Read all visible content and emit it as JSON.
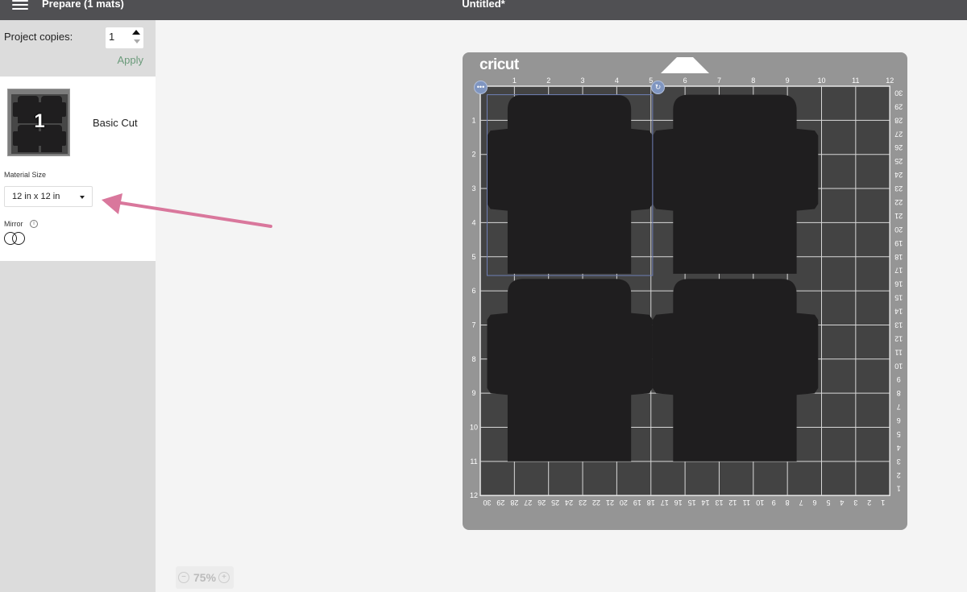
{
  "topbar": {
    "menu_icon": "hamburger-menu-icon",
    "prepare_label": "Prepare (1 mats)",
    "project_title": "Untitled*"
  },
  "left_panel": {
    "project_copies_label": "Project copies:",
    "project_copies_value": "1",
    "apply_label": "Apply",
    "mat": {
      "number": "1",
      "cut_type": "Basic Cut",
      "material_size_label": "Material Size",
      "material_size_value": "12 in x 12 in",
      "mirror_label": "Mirror",
      "mirror_on": false
    }
  },
  "canvas": {
    "zoom_level": "75%",
    "zoom_out_icon": "minus-icon",
    "zoom_in_icon": "plus-icon",
    "annotation_arrow_color": "#d9779c",
    "mat": {
      "brand": "cricut",
      "size_in": [
        12,
        12
      ],
      "top_ruler": [
        "1",
        "2",
        "3",
        "4",
        "5",
        "6",
        "7",
        "8",
        "9",
        "10",
        "11",
        "12"
      ],
      "left_ruler": [
        "1",
        "2",
        "3",
        "4",
        "5",
        "6",
        "7",
        "8",
        "9",
        "10",
        "11",
        "12"
      ],
      "right_ruler_cm": [
        "30",
        "29",
        "28",
        "27",
        "26",
        "25",
        "24",
        "23",
        "22",
        "21",
        "20",
        "19",
        "18",
        "17",
        "16",
        "15",
        "14",
        "13",
        "12",
        "11",
        "10",
        "9",
        "8",
        "7",
        "6",
        "5",
        "4",
        "3",
        "2",
        "1"
      ],
      "bottom_ruler_cm": [
        "30",
        "29",
        "28",
        "27",
        "26",
        "25",
        "24",
        "23",
        "22",
        "21",
        "20",
        "19",
        "18",
        "17",
        "16",
        "15",
        "14",
        "13",
        "12",
        "11",
        "10",
        "9",
        "8",
        "7",
        "6",
        "5",
        "4",
        "3",
        "2",
        "1"
      ],
      "shapes_count": 4,
      "selection_handle_left_icon": "more-options-icon",
      "selection_handle_right_icon": "rotate-icon"
    }
  }
}
